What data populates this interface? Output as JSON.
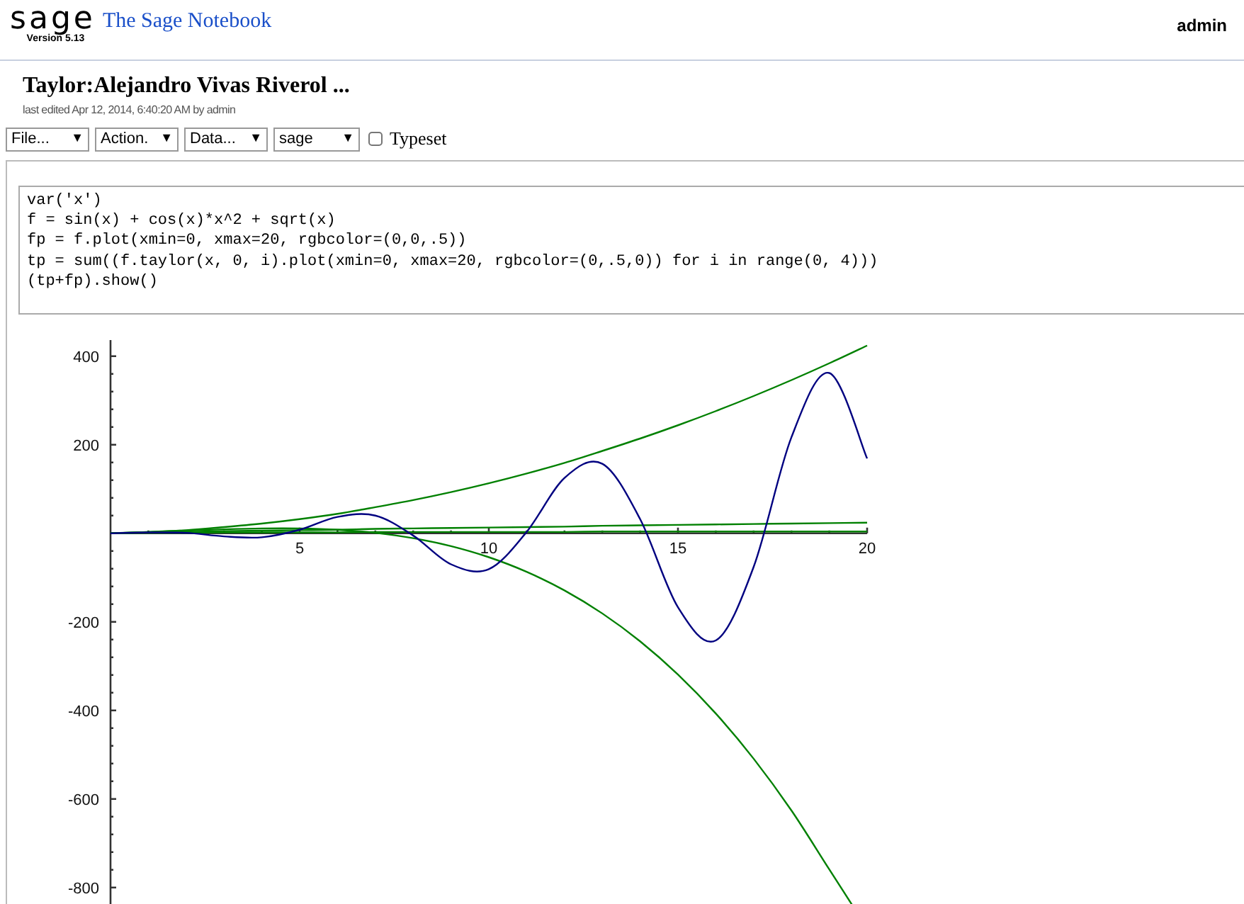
{
  "header": {
    "logo": "sage",
    "version": "Version 5.13",
    "title": "The Sage Notebook",
    "user": "admin"
  },
  "worksheet": {
    "title": "Taylor:Alejandro Vivas Riverol ...",
    "last_edited": "last edited Apr 12, 2014, 6:40:20 AM by admin"
  },
  "toolbar": {
    "menus": [
      {
        "label": "File...",
        "arrow": "▼"
      },
      {
        "label": "Action.",
        "arrow": "▼"
      },
      {
        "label": "Data...",
        "arrow": "▼"
      },
      {
        "label": "sage",
        "arrow": "▼"
      }
    ],
    "typeset": {
      "label": "Typeset",
      "checked": false
    }
  },
  "cell": {
    "code": [
      "var('x')",
      "f = sin(x) + cos(x)*x^2 + sqrt(x)",
      "fp = f.plot(xmin=0, xmax=20, rgbcolor=(0,0,.5))",
      "tp = sum((f.taylor(x, 0, i).plot(xmin=0, xmax=20, rgbcolor=(0,.5,0)) for i in range(0, 4)))",
      "(tp+fp).show()"
    ]
  },
  "chart_data": {
    "type": "line",
    "x": [
      0,
      1,
      2,
      3,
      4,
      5,
      6,
      7,
      8,
      9,
      10,
      11,
      12,
      13,
      14,
      15,
      16,
      17,
      18,
      19,
      20
    ],
    "xlim": [
      0,
      20
    ],
    "ylim": [
      -882,
      430
    ],
    "xticks": [
      5,
      10,
      15,
      20
    ],
    "yticks": [
      -800,
      -600,
      -400,
      -200,
      200,
      400
    ],
    "series": [
      {
        "color": "#008000",
        "values": [
          0,
          1,
          1,
          2,
          2,
          2,
          2,
          3,
          3,
          3,
          3,
          3,
          3,
          4,
          4,
          4,
          4,
          4,
          4,
          4,
          4
        ]
      },
      {
        "color": "#008000",
        "values": [
          0,
          2,
          3,
          5,
          6,
          7,
          8,
          10,
          11,
          12,
          13,
          14,
          15,
          17,
          18,
          19,
          20,
          21,
          22,
          23,
          24
        ]
      },
      {
        "color": "#008000",
        "values": [
          0,
          3,
          7,
          14,
          22,
          32,
          44,
          59,
          75,
          93,
          113,
          135,
          159,
          186,
          214,
          244,
          276,
          310,
          346,
          384,
          424
        ]
      },
      {
        "color": "#008000",
        "values": [
          0,
          3,
          6,
          9,
          11,
          11,
          8,
          1,
          -11,
          -29,
          -54,
          -87,
          -129,
          -181,
          -244,
          -319,
          -407,
          -509,
          -626,
          -759,
          null
        ]
      },
      {
        "color": "#000080",
        "values": [
          0,
          2,
          1,
          -7,
          -9,
          8,
          37,
          40,
          -5,
          -70,
          -81,
          3,
          125,
          157,
          32,
          -167,
          -242,
          -76,
          217,
          362,
          169
        ]
      }
    ]
  }
}
